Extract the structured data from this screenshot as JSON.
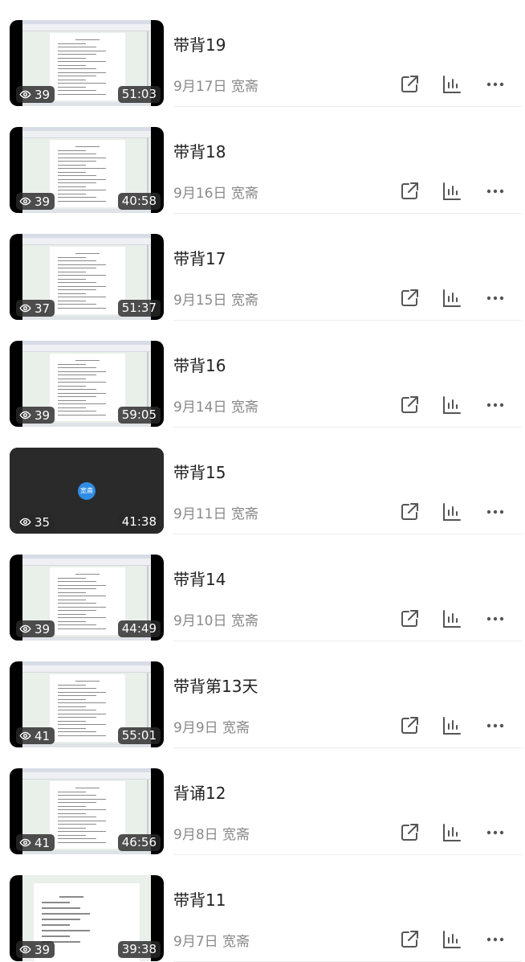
{
  "videos": [
    {
      "title": "带背19",
      "date": "9月17日",
      "author": "宽斋",
      "views": "39",
      "duration": "51:03",
      "thumb": "document"
    },
    {
      "title": "带背18",
      "date": "9月16日",
      "author": "宽斋",
      "views": "39",
      "duration": "40:58",
      "thumb": "document"
    },
    {
      "title": "带背17",
      "date": "9月15日",
      "author": "宽斋",
      "views": "37",
      "duration": "51:37",
      "thumb": "document"
    },
    {
      "title": "带背16",
      "date": "9月14日",
      "author": "宽斋",
      "views": "39",
      "duration": "59:05",
      "thumb": "document"
    },
    {
      "title": "带背15",
      "date": "9月11日",
      "author": "宽斋",
      "views": "35",
      "duration": "41:38",
      "thumb": "avatar",
      "avatar_text": "宽斋"
    },
    {
      "title": "带背14",
      "date": "9月10日",
      "author": "宽斋",
      "views": "39",
      "duration": "44:49",
      "thumb": "document"
    },
    {
      "title": "带背第13天",
      "date": "9月9日",
      "author": "宽斋",
      "views": "41",
      "duration": "55:01",
      "thumb": "document"
    },
    {
      "title": "背诵12",
      "date": "9月8日",
      "author": "宽斋",
      "views": "41",
      "duration": "46:56",
      "thumb": "document"
    },
    {
      "title": "带背11",
      "date": "9月7日",
      "author": "宽斋",
      "views": "39",
      "duration": "39:38",
      "thumb": "document-large"
    }
  ],
  "icons": {
    "views": "eye-icon",
    "share": "share-icon",
    "stats": "bar-chart-icon",
    "more": "more-horizontal-icon"
  },
  "colors": {
    "title": "#222222",
    "meta": "#8a8a8a",
    "icon": "#555555",
    "avatar": "#2f8de4"
  }
}
